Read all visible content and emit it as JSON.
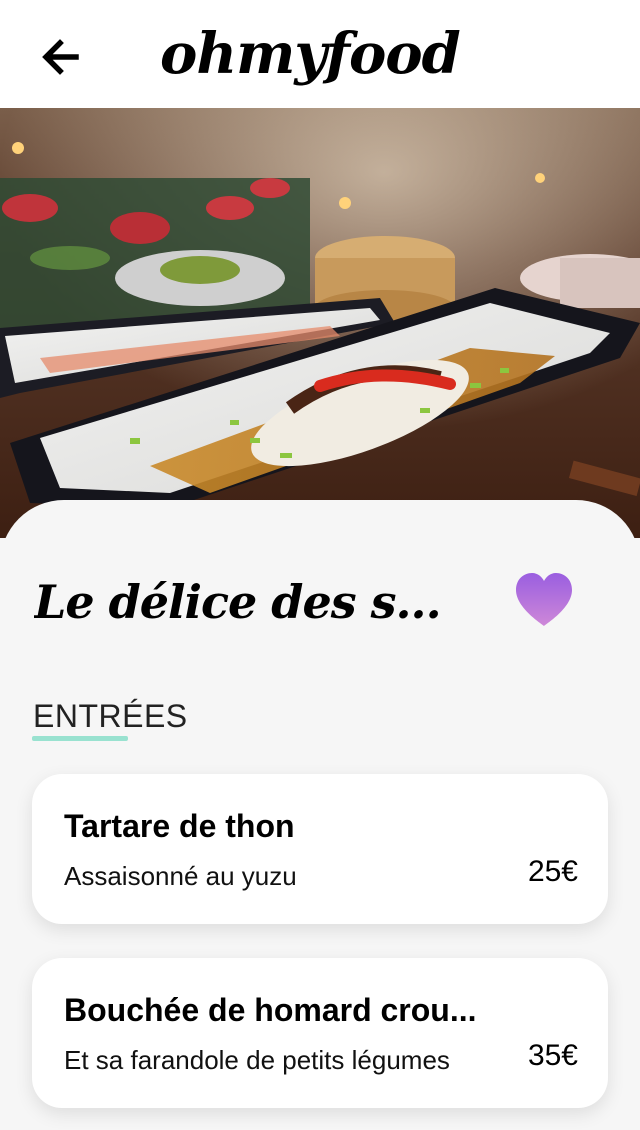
{
  "header": {
    "logo": "ohmyfood",
    "back_icon": "arrow-left-icon"
  },
  "hero": {
    "image_subject": "plated fish dish on dark ceramic platter in restaurant"
  },
  "restaurant": {
    "title": "Le délice des s...",
    "like_icon": "heart-icon",
    "like_color": "#b36fe0"
  },
  "menu": {
    "section_title": "ENTRÉES",
    "accent_color": "#99e2d0",
    "dishes": [
      {
        "name": "Tartare de thon",
        "description": "Assaisonné au yuzu",
        "price": "25€"
      },
      {
        "name": "Bouchée de homard crou...",
        "description": "Et sa farandole de petits légumes",
        "price": "35€"
      }
    ]
  }
}
